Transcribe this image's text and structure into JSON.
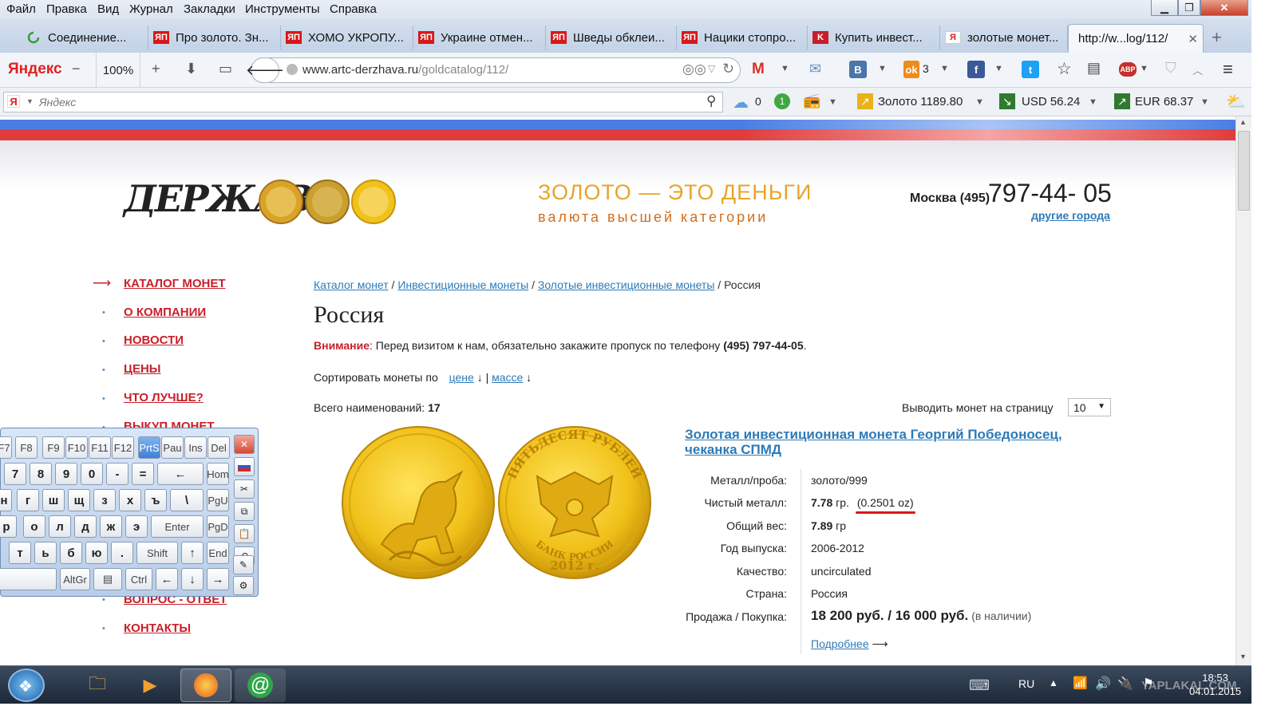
{
  "menu": [
    "Файл",
    "Правка",
    "Вид",
    "Журнал",
    "Закладки",
    "Инструменты",
    "Справка"
  ],
  "tabs": [
    {
      "label": "Соединение...",
      "icon": "loading-icon"
    },
    {
      "label": "Про золото. Зн...",
      "icon": "yaplakal-icon"
    },
    {
      "label": "ХОМО УКРОПУ...",
      "icon": "yaplakal-icon"
    },
    {
      "label": "Украине отмен...",
      "icon": "yaplakal-icon"
    },
    {
      "label": "Шведы обклеи...",
      "icon": "yaplakal-icon"
    },
    {
      "label": "Наци​ки стопро...",
      "icon": "yaplakal-icon"
    },
    {
      "label": "Купить инвест...",
      "icon": "site-icon"
    },
    {
      "label": "золотые монет...",
      "icon": "yandex-icon"
    },
    {
      "label": "http://w...log/112/",
      "icon": "none",
      "active": true
    }
  ],
  "nav": {
    "brand": "Яндекс",
    "zoom": "100%",
    "url_host": "www.artc-derzhava.ru",
    "url_path": "/goldcatalog/112/",
    "ok_count": "3"
  },
  "ybar": {
    "search_placeholder": "Яндекс",
    "cloud_count": "0",
    "badge_count": "1",
    "gold": "Золото 1189.80",
    "usd": "USD 56.24",
    "eur": "EUR 68.37"
  },
  "site": {
    "logo": "ДЕРЖАВА",
    "slogan": "ЗОЛОТО — ЭТО ДЕНЬГИ",
    "subslogan": "валюта высшей категории",
    "city": "Москва (495)",
    "phone": "797-44- 05",
    "other_cities": "другие города"
  },
  "sidenav": [
    {
      "label": "КАТАЛОГ МОНЕТ",
      "active": true
    },
    {
      "label": "О КОМПАНИИ"
    },
    {
      "label": "НОВОСТИ"
    },
    {
      "label": "ЦЕНЫ"
    },
    {
      "label": "ЧТО ЛУЧШЕ?"
    },
    {
      "label": "ВЫКУП МОНЕТ"
    },
    {
      "label": "ВОПРОС - ОТВЕТ"
    },
    {
      "label": "КОНТАКТЫ"
    }
  ],
  "breadcrumb": [
    "Каталог монет",
    "Инвестиционные монеты",
    "Золотые инвестиционные монеты",
    "Россия"
  ],
  "page_title": "Россия",
  "notice": {
    "label": "Внимание",
    "text": ": Перед визитом к нам, обязательно закажите пропуск по телефону ",
    "phone": "(495) 797-44-05",
    "end": "."
  },
  "sort": {
    "label": "Сортировать монеты по",
    "price": "цене",
    "mass": "массе",
    "sep": "|",
    "arrow": "↓"
  },
  "total": {
    "label": "Всего наименований:",
    "value": "17"
  },
  "per_page": {
    "label": "Выводить монет на страницу",
    "value": "10"
  },
  "coin": {
    "title_line1": "Золотая инвестиционная монета Георгий Победоносец,",
    "title_line2": "чеканка СПМД",
    "reverse_text": "ПЯТЬДЕСЯТ РУБЛЕЙ",
    "reverse_bottom": "БАНК РОССИИ",
    "reverse_year": "2012 г.",
    "specs": [
      {
        "label": "Металл/проба:",
        "value": "золото/999"
      },
      {
        "label": "Чистый металл:",
        "value": "7.78",
        "unit": "гр.",
        "extra": "(0.2501 oz)"
      },
      {
        "label": "Общий вес:",
        "value": "7.89",
        "unit": "гр"
      },
      {
        "label": "Год выпуска:",
        "value": "2006-2012"
      },
      {
        "label": "Качество:",
        "value": "uncirculated"
      },
      {
        "label": "Страна:",
        "value": "Россия"
      },
      {
        "label": "Продажа / Покупка:",
        "value": "18 200 руб. / 16 000 руб.",
        "extra": "(в наличии)"
      }
    ],
    "more": "Подробнее"
  },
  "keyboard": {
    "row0": [
      "F7",
      "F8",
      "F9",
      "F10",
      "F11",
      "F12",
      "PrtS",
      "Pau",
      "Ins",
      "Del"
    ],
    "row1": [
      "7",
      "8",
      "9",
      "0",
      "-",
      "=",
      "←",
      "Hom"
    ],
    "row2": [
      "н",
      "г",
      "ш",
      "щ",
      "з",
      "х",
      "ъ",
      "\\",
      "PgU"
    ],
    "row3": [
      "р",
      "о",
      "л",
      "д",
      "ж",
      "э",
      "Enter",
      "PgD"
    ],
    "row4": [
      "т",
      "ь",
      "б",
      "ю",
      ".",
      "Shift",
      "↑",
      "End"
    ],
    "row5": [
      "AltGr",
      "Ctrl",
      "←",
      "↓",
      "→"
    ]
  },
  "taskbar": {
    "lang": "RU",
    "time": "18:53",
    "date": "04.01.2015",
    "watermark": "YAPLAKAL.COM"
  },
  "colors": {
    "accent_red": "#c8202a",
    "link_blue": "#2d7ab8",
    "gold": "#e8b21a",
    "slogan_orange": "#e8a42a"
  }
}
